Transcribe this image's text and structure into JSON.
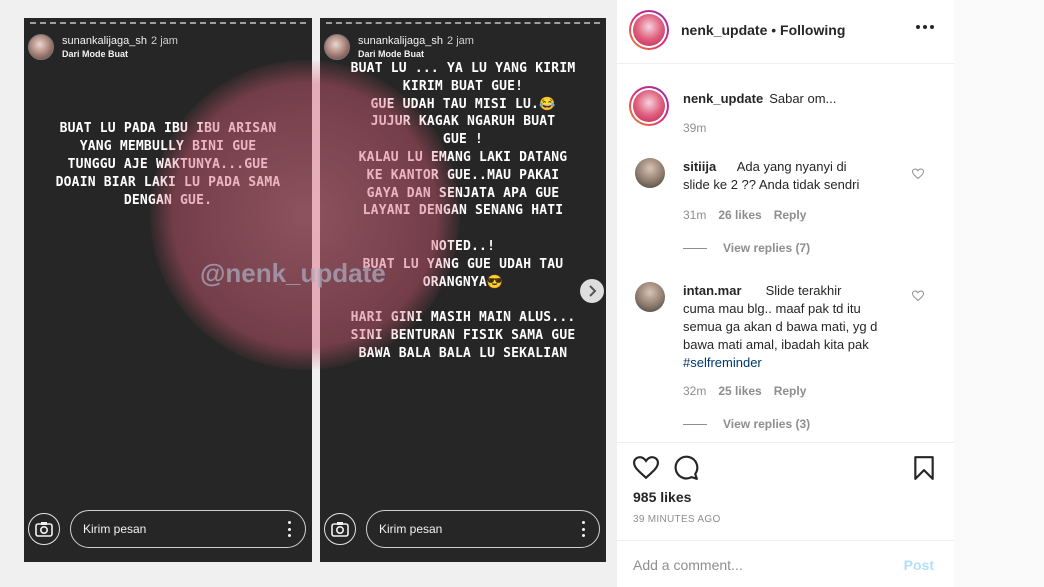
{
  "post": {
    "stories": [
      {
        "username": "sunankalijaga_sh",
        "time": "2 jam",
        "subtitle": "Dari Mode Buat",
        "text": "BUAT LU PADA IBU IBU ARISAN\nYANG MEMBULLY BINI GUE\nTUNGGU AJE WAKTUNYA...GUE\nDOAIN BIAR LAKI LU PADA SAMA\nDENGAN GUE.",
        "message_placeholder": "Kirim pesan"
      },
      {
        "username": "sunankalijaga_sh",
        "time": "2 jam",
        "subtitle": "Dari Mode Buat",
        "text": "BUAT LU ... YA LU YANG KIRIM\nKIRIM BUAT GUE!\nGUE UDAH TAU MISI LU.😂\nJUJUR KAGAK NGARUH BUAT\nGUE !\nKALAU LU EMANG LAKI DATANG\nKE KANTOR GUE..MAU PAKAI\nGAYA DAN SENJATA APA GUE\nLAYANI DENGAN SENANG HATI\n\nNOTED..!\nBUAT LU YANG GUE UDAH TAU\nORANGNYA😎\n\nHARI GINI MASIH MAIN ALUS...\nSINI BENTURAN FISIK SAMA GUE\nBAWA BALA BALA LU SEKALIAN",
        "message_placeholder": "Kirim pesan"
      }
    ],
    "watermark": "@nenk_update"
  },
  "header": {
    "username": "nenk_update",
    "separator": "•",
    "following": "Following"
  },
  "caption": {
    "username": "nenk_update",
    "text": "Sabar om...",
    "time": "39m"
  },
  "comments": [
    {
      "username": "sitiija",
      "text": "Ada yang nyanyi di slide ke 2 ?? Anda tidak sendri",
      "line1": "Ada yang nyanyi di",
      "line2": "slide ke 2 ?? Anda tidak sendri",
      "time": "31m",
      "likes": "26 likes",
      "reply": "Reply",
      "view_replies": "View replies (7)"
    },
    {
      "username": "intan.mar",
      "line1": "Slide terakhir",
      "line2": "cuma mau blg.. maaf pak td itu",
      "line3": "semua ga akan d bawa mati, yg d",
      "line4": "bawa mati amal, ibadah kita pak",
      "hashtag": "#selfreminder",
      "time": "32m",
      "likes": "25 likes",
      "reply": "Reply",
      "view_replies": "View replies (3)"
    }
  ],
  "actions": {
    "likes": "985 likes",
    "time_ago": "39 MINUTES AGO"
  },
  "add_comment": {
    "placeholder": "Add a comment...",
    "post_label": "Post"
  },
  "colors": {
    "story_bg": "#262626",
    "link_blue": "#00376b",
    "post_disabled": "#b2dffc",
    "meta_gray": "#8e8e8e"
  }
}
